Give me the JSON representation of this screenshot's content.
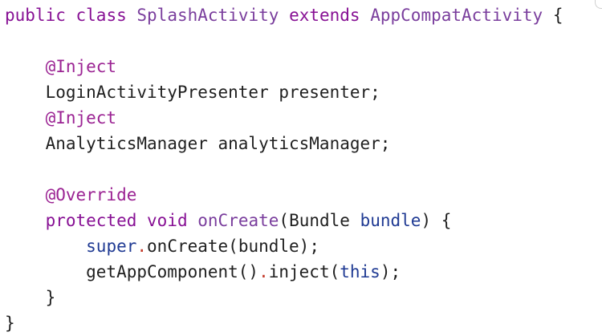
{
  "colors": {
    "keyword": "#871094",
    "type": "#7a3e9d",
    "annotation": "#9b2393",
    "method": "#7a3e9d",
    "parameter": "#1f3a93",
    "plain": "#1f1f1f",
    "dot": "#c43b2b"
  },
  "code_lines": [
    [
      {
        "t": "public",
        "k": "keyword"
      },
      {
        "t": " ",
        "k": "plain"
      },
      {
        "t": "class",
        "k": "keyword"
      },
      {
        "t": " ",
        "k": "plain"
      },
      {
        "t": "SplashActivity",
        "k": "type"
      },
      {
        "t": " ",
        "k": "plain"
      },
      {
        "t": "extends",
        "k": "keyword"
      },
      {
        "t": " ",
        "k": "plain"
      },
      {
        "t": "AppCompatActivity",
        "k": "type"
      },
      {
        "t": " {",
        "k": "plain"
      }
    ],
    [],
    [
      {
        "t": "    ",
        "k": "plain"
      },
      {
        "t": "@Inject",
        "k": "annotation"
      }
    ],
    [
      {
        "t": "    LoginActivityPresenter presenter;",
        "k": "plain"
      }
    ],
    [
      {
        "t": "    ",
        "k": "plain"
      },
      {
        "t": "@Inject",
        "k": "annotation"
      }
    ],
    [
      {
        "t": "    AnalyticsManager analyticsManager;",
        "k": "plain"
      }
    ],
    [],
    [
      {
        "t": "    ",
        "k": "plain"
      },
      {
        "t": "@Override",
        "k": "annotation"
      }
    ],
    [
      {
        "t": "    ",
        "k": "plain"
      },
      {
        "t": "protected",
        "k": "keyword"
      },
      {
        "t": " ",
        "k": "plain"
      },
      {
        "t": "void",
        "k": "keyword"
      },
      {
        "t": " ",
        "k": "plain"
      },
      {
        "t": "onCreate",
        "k": "method"
      },
      {
        "t": "(Bundle ",
        "k": "plain"
      },
      {
        "t": "bundle",
        "k": "parameter"
      },
      {
        "t": ") {",
        "k": "plain"
      }
    ],
    [
      {
        "t": "        ",
        "k": "plain"
      },
      {
        "t": "super",
        "k": "parameter"
      },
      {
        "t": ".",
        "k": "dot"
      },
      {
        "t": "onCreate(bundle);",
        "k": "plain"
      }
    ],
    [
      {
        "t": "        getAppComponent()",
        "k": "plain"
      },
      {
        "t": ".",
        "k": "dot"
      },
      {
        "t": "inject(",
        "k": "plain"
      },
      {
        "t": "this",
        "k": "parameter"
      },
      {
        "t": ");",
        "k": "plain"
      }
    ],
    [
      {
        "t": "    }",
        "k": "plain"
      }
    ],
    [
      {
        "t": "}",
        "k": "plain"
      }
    ]
  ]
}
